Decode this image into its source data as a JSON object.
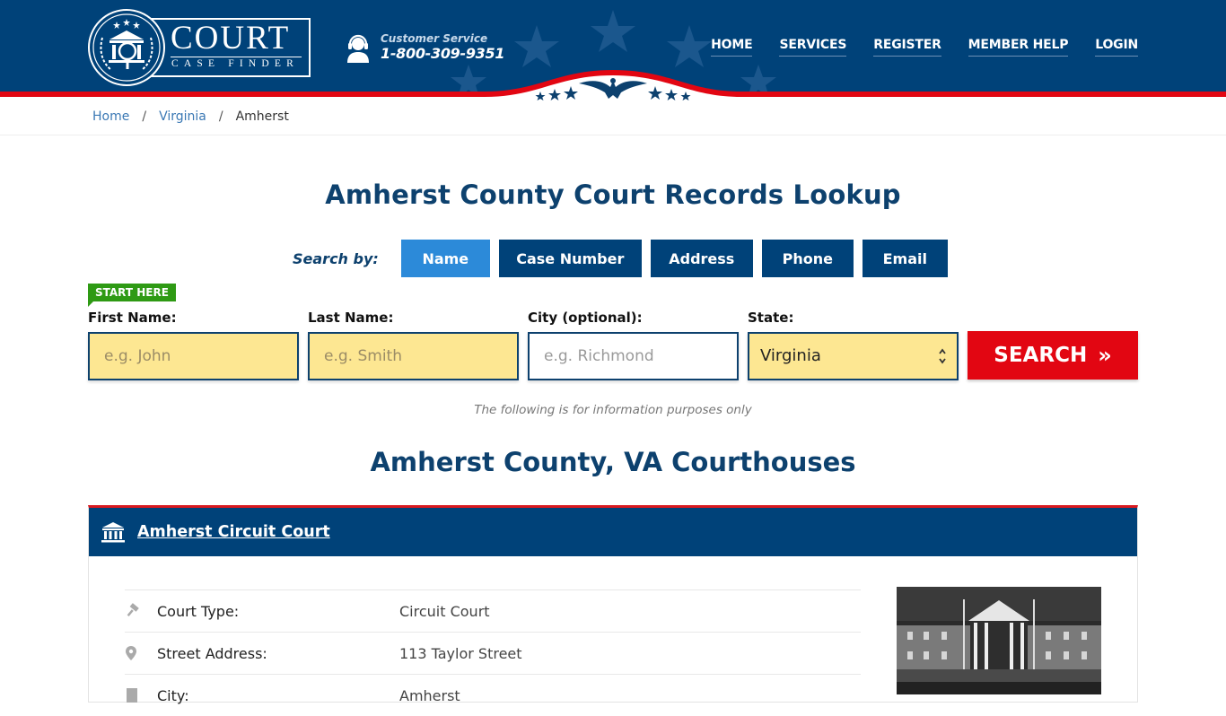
{
  "header": {
    "logo": {
      "title": "COURT",
      "subtitle": "CASE FINDER"
    },
    "customer_service": {
      "label": "Customer Service",
      "phone": "1-800-309-9351"
    },
    "nav": [
      {
        "label": "HOME"
      },
      {
        "label": "SERVICES"
      },
      {
        "label": "REGISTER"
      },
      {
        "label": "MEMBER HELP"
      },
      {
        "label": "LOGIN"
      }
    ]
  },
  "breadcrumb": {
    "items": [
      {
        "label": "Home"
      },
      {
        "label": "Virginia"
      },
      {
        "label": "Amherst"
      }
    ],
    "separator": "/"
  },
  "main": {
    "title": "Amherst County Court Records Lookup",
    "search_by": {
      "label": "Search by:",
      "tabs": [
        {
          "label": "Name",
          "active": true
        },
        {
          "label": "Case Number",
          "active": false
        },
        {
          "label": "Address",
          "active": false
        },
        {
          "label": "Phone",
          "active": false
        },
        {
          "label": "Email",
          "active": false
        }
      ]
    },
    "form": {
      "start_here": "START HERE",
      "first_name": {
        "label": "First Name:",
        "placeholder": "e.g. John",
        "value": ""
      },
      "last_name": {
        "label": "Last Name:",
        "placeholder": "e.g. Smith",
        "value": ""
      },
      "city": {
        "label": "City (optional):",
        "placeholder": "e.g.  Richmond",
        "value": ""
      },
      "state": {
        "label": "State:",
        "selected": "Virginia"
      },
      "search_button": "SEARCH",
      "search_button_icon": "»"
    },
    "disclaimer": "The following is for information purposes only",
    "courthouses_title": "Amherst County, VA Courthouses",
    "courts": [
      {
        "name": "Amherst Circuit Court",
        "details": [
          {
            "icon": "gavel-icon",
            "key": "Court Type:",
            "value": "Circuit Court"
          },
          {
            "icon": "map-pin-icon",
            "key": "Street Address:",
            "value": "113 Taylor Street"
          },
          {
            "icon": "building-icon",
            "key": "City:",
            "value": "Amherst"
          }
        ]
      }
    ]
  },
  "colors": {
    "brand_blue": "#004279",
    "active_tab": "#2c8ad9",
    "accent_red": "#e20612",
    "input_yellow": "#fde792",
    "start_green": "#2e9a14",
    "title_blue": "#0d416e"
  }
}
